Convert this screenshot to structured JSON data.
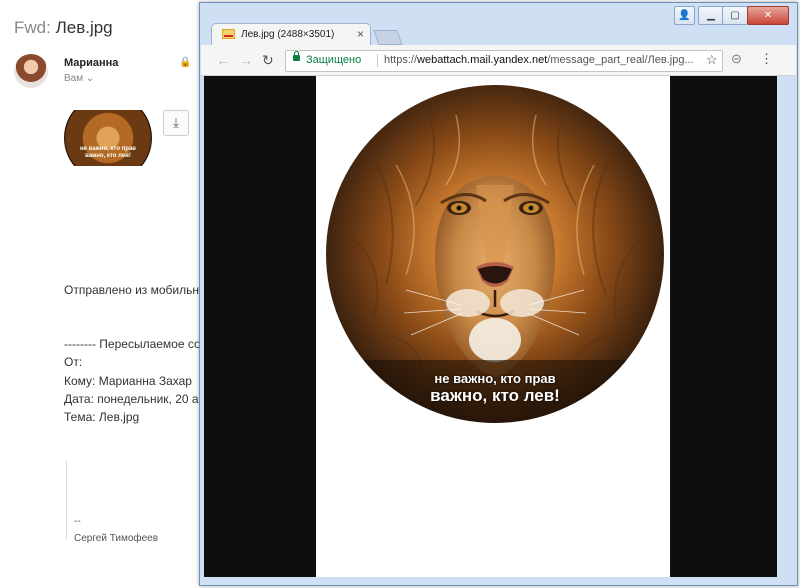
{
  "mail": {
    "subject_prefix": "Fwd:",
    "subject": "Лев.jpg",
    "sender": "Марианна",
    "recipient": "Вам",
    "recipient_chevron": "chevron-down-icon",
    "sent_from": "Отправлено из мобильн",
    "forwarded_header": "-------- Пересылаемое со",
    "from_label": "От:",
    "to_line": "Кому: Марианна Захар",
    "date_line": "Дата: понедельник, 20 а",
    "topic_line": "Тема: Лев.jpg",
    "signature_dash": "--",
    "signature_name": "Сергей Тимофеев"
  },
  "attachment": {
    "caption_line1": "не важно, кто прав",
    "caption_line2": "важно, кто лев!",
    "download_icon": "download-icon"
  },
  "browser": {
    "tab_title": "Лев.jpg (2488×3501)",
    "secure_label": "Защищено",
    "url_scheme": "https://",
    "url_host": "webattach.mail.yandex.net",
    "url_path": "/message_part_real/Лев.jpg...",
    "window_buttons": [
      "user-icon",
      "minimize-icon",
      "maximize-icon",
      "close-icon"
    ],
    "accent": "#0b8043"
  },
  "image": {
    "caption_line1": "не важно, кто прав",
    "caption_line2": "важно, кто лев!"
  }
}
